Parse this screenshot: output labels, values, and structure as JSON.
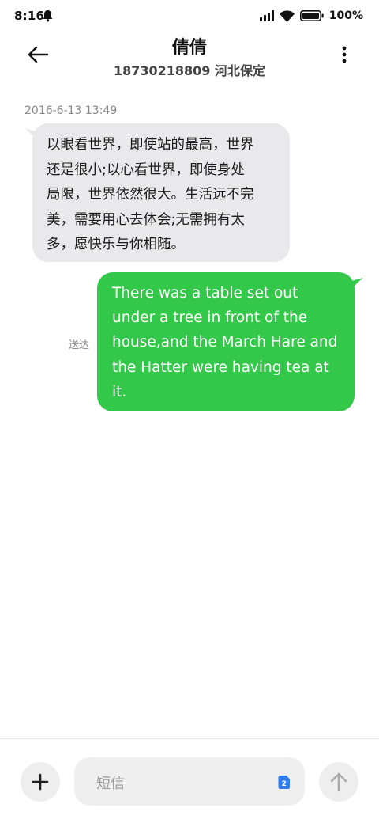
{
  "status_bar": {
    "time": "8:16",
    "battery": "100%"
  },
  "header": {
    "contact_name": "倩倩",
    "contact_detail": "18730218809 河北保定"
  },
  "conversation": {
    "timestamp": "2016-6-13 13:49",
    "incoming": {
      "lines": [
        "以眼看世界，即使站的最高，世界",
        "还是很小;以心看世界，即使身处",
        "局限，世界依然很大。生活远不完",
        "美，需要用心去体会;无需拥有太",
        "多，愿快乐与你相随。"
      ],
      "bubble_color": "#e9e9eb"
    },
    "outgoing": {
      "lines": [
        "There was a table set out",
        "under a tree in front of the",
        "house,and the March Hare and",
        "the Hatter were having tea at",
        "it."
      ],
      "status": "送达",
      "bubble_color": "#34c84a"
    }
  },
  "composer": {
    "placeholder": "短信",
    "sim_label": "2"
  },
  "icons": {
    "back": "arrow-left-icon",
    "more": "more-vertical-icon",
    "add": "plus-icon",
    "send": "arrow-up-icon",
    "notification": "bell-icon",
    "signal": "signal-icon",
    "wifi": "wifi-icon",
    "battery": "battery-icon",
    "sim": "sim-card-icon"
  },
  "colors": {
    "accent_green": "#34c84a",
    "sim_blue": "#2f7bf5"
  }
}
